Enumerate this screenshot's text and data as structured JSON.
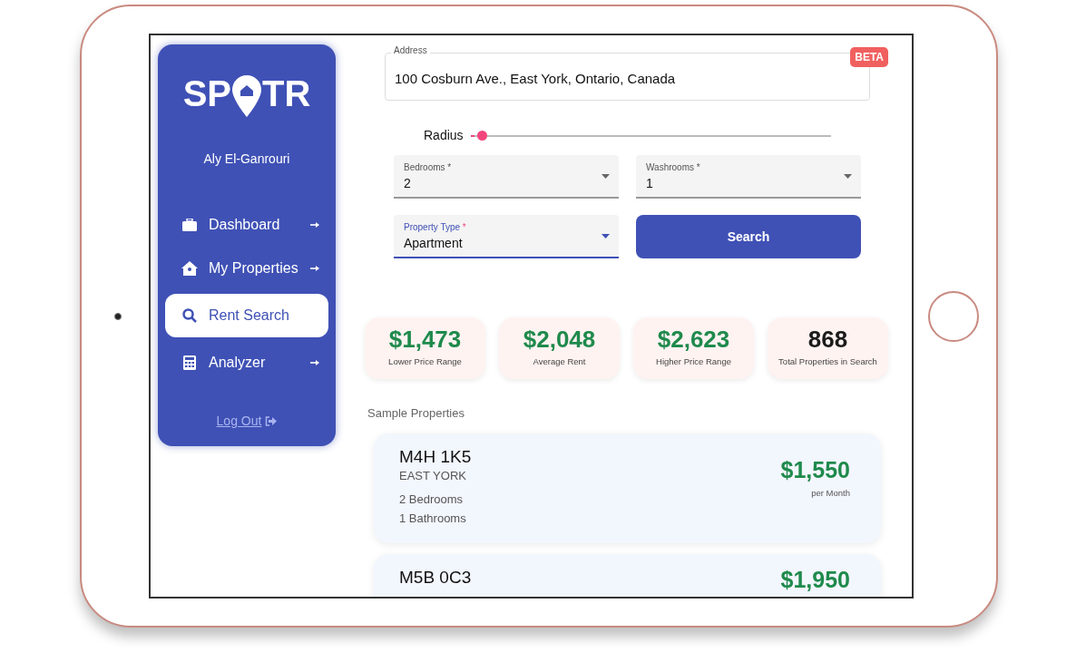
{
  "logo": {
    "left": "SP",
    "right": "TR"
  },
  "user_name": "Aly El-Ganrouri",
  "nav": [
    {
      "label": "Dashboard",
      "kind": "briefcase",
      "selected": false
    },
    {
      "label": "My Properties",
      "kind": "house",
      "selected": false
    },
    {
      "label": "Rent Search",
      "kind": "search",
      "selected": true
    },
    {
      "label": "Analyzer",
      "kind": "calculator",
      "selected": false
    }
  ],
  "logout": "Log Out",
  "address": {
    "label": "Address",
    "value": "100 Cosburn Ave., East York, Ontario, Canada"
  },
  "badge": "BETA",
  "radius": {
    "label": "Radius",
    "level": 0.01
  },
  "selects": [
    {
      "label": "Bedrooms",
      "required_mark": "*",
      "value": "2",
      "focused": false
    },
    {
      "label": "Washrooms",
      "required_mark": "*",
      "value": "1",
      "focused": false
    },
    {
      "label": "Property Type",
      "required_mark": "*",
      "value": "Apartment",
      "focused": true
    }
  ],
  "search_button": "Search",
  "stats": [
    {
      "value": "$1,473",
      "label": "Lower Price Range",
      "kind": "price"
    },
    {
      "value": "$2,048",
      "label": "Average Rent",
      "kind": "price"
    },
    {
      "value": "$2,623",
      "label": "Higher Price Range",
      "kind": "price"
    },
    {
      "value": "868",
      "label": "Total Properties in Search",
      "kind": "count"
    }
  ],
  "section_title": "Sample Properties",
  "properties": [
    {
      "postal_code": "M4H 1K5",
      "area": "EAST YORK",
      "bedrooms": "2 Bedrooms",
      "bathrooms": "1 Bathrooms",
      "price": "$1,550",
      "period": "per Month"
    },
    {
      "postal_code": "M5B 0C3",
      "price": "$1,950"
    }
  ]
}
